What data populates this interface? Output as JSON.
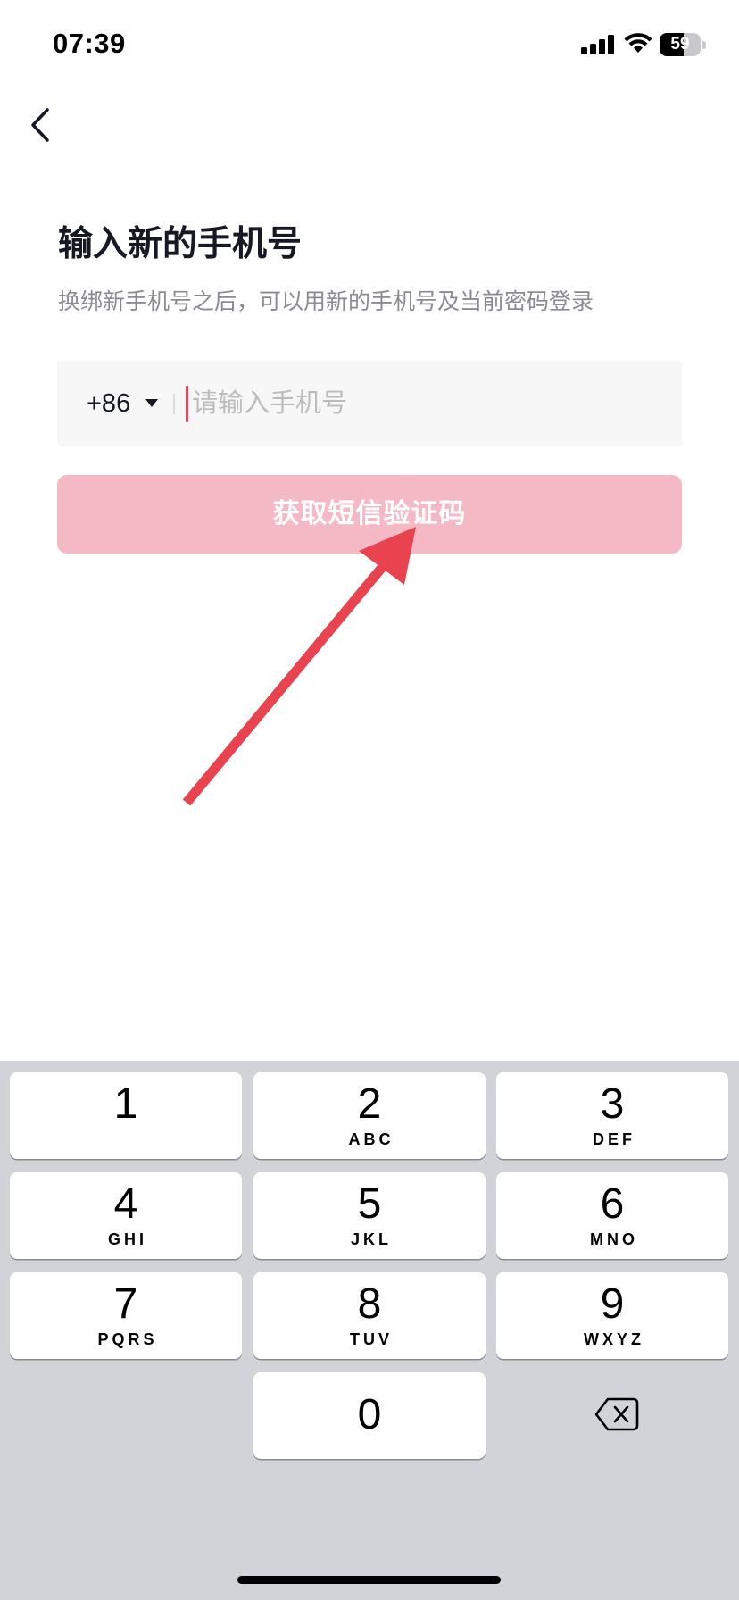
{
  "status_bar": {
    "time": "07:39",
    "battery_level": "59",
    "signal_icon": "cellular-signal-icon",
    "wifi_icon": "wifi-icon",
    "battery_icon": "battery-icon"
  },
  "nav": {
    "back_icon": "chevron-left-icon"
  },
  "page": {
    "title": "输入新的手机号",
    "subtitle": "换绑新手机号之后，可以用新的手机号及当前密码登录"
  },
  "phone_input": {
    "country_code": "+86",
    "dropdown_icon": "caret-down-icon",
    "placeholder": "请输入手机号",
    "value": ""
  },
  "submit_button": {
    "label": "获取短信验证码"
  },
  "annotation": {
    "arrow_icon": "red-arrow-pointer-icon"
  },
  "keyboard": {
    "keys": [
      {
        "digit": "1",
        "letters": ""
      },
      {
        "digit": "2",
        "letters": "ABC"
      },
      {
        "digit": "3",
        "letters": "DEF"
      },
      {
        "digit": "4",
        "letters": "GHI"
      },
      {
        "digit": "5",
        "letters": "JKL"
      },
      {
        "digit": "6",
        "letters": "MNO"
      },
      {
        "digit": "7",
        "letters": "PQRS"
      },
      {
        "digit": "8",
        "letters": "TUV"
      },
      {
        "digit": "9",
        "letters": "WXYZ"
      },
      {
        "digit": "0",
        "letters": ""
      }
    ],
    "delete_icon": "backspace-icon"
  },
  "colors": {
    "accent_cursor": "#e9445a",
    "button_background": "#f4b9c5",
    "arrow": "#e8434f",
    "keyboard_background": "#d1d3d9",
    "text_primary": "#161823",
    "text_secondary": "#8a8b91"
  }
}
